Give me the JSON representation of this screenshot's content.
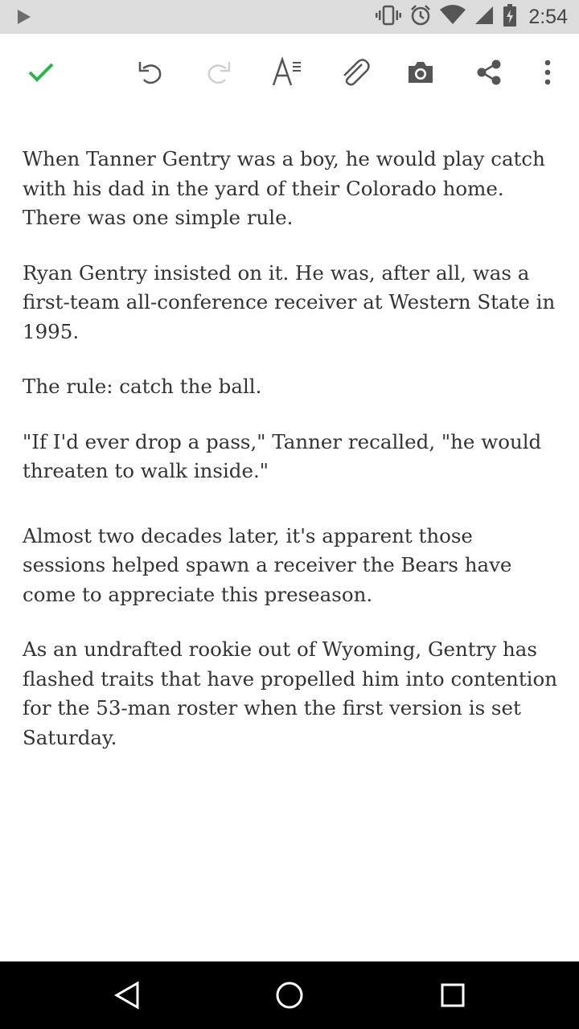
{
  "status_bar": {
    "time": "2:54",
    "icons": [
      "play-icon",
      "vibrate-icon",
      "alarm-icon",
      "wifi-icon",
      "signal-icon",
      "battery-charging-icon"
    ]
  },
  "toolbar": {
    "icons": [
      "check-icon",
      "undo-icon",
      "redo-icon",
      "text-format-icon",
      "attach-icon",
      "camera-icon",
      "share-icon",
      "more-vert-icon"
    ],
    "accent_color": "#2db34a"
  },
  "note": {
    "paragraphs": [
      "When Tanner Gentry was a boy, he would play catch with his dad in the yard of their Colorado home. There was one simple rule.",
      "Ryan Gentry insisted on it. He was, after all, was a first-team all-conference receiver at Western State in 1995.",
      "The rule: catch the ball.",
      "\"If I'd ever drop a pass,\" Tanner recalled, \"he would threaten to walk inside.\"",
      "Almost two decades later, it's apparent those sessions helped spawn a receiver the Bears have come to appreciate this preseason.",
      "As an undrafted rookie out of Wyoming, Gentry has flashed traits that have propelled him into contention for the 53-man roster when the first version is set Saturday."
    ]
  },
  "nav_bar": {
    "icons": [
      "back-icon",
      "home-icon",
      "recents-icon"
    ]
  }
}
